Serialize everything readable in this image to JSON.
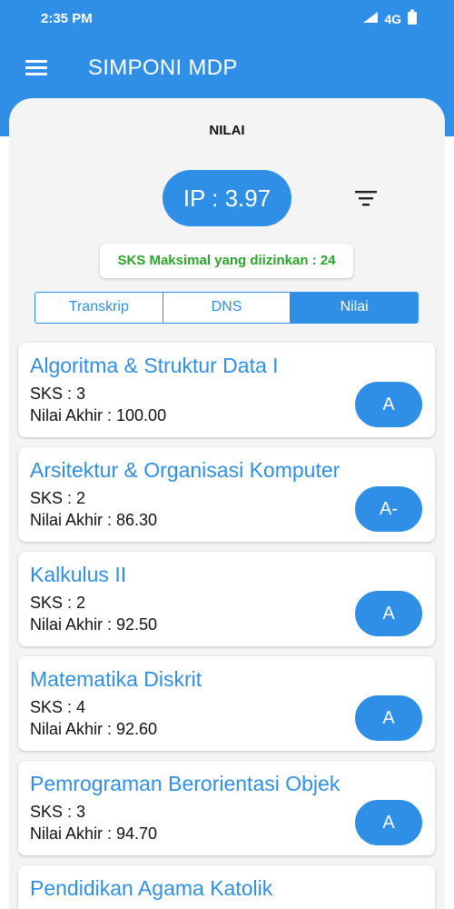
{
  "status_bar": {
    "time": "2:35 PM",
    "network": "4G",
    "icons": [
      "signal-icon",
      "network-4g-icon",
      "battery-icon"
    ]
  },
  "app_bar": {
    "title": "SIMPONI MDP",
    "menu_icon": "hamburger-menu-icon"
  },
  "page": {
    "title": "NILAI",
    "ip_text": "IP : 3.97",
    "filter_icon": "filter-icon",
    "sks_max_text": "SKS Maksimal yang diizinkan : 24"
  },
  "tabs": [
    {
      "label": "Transkrip",
      "active": false
    },
    {
      "label": "DNS",
      "active": false
    },
    {
      "label": "Nilai",
      "active": true
    }
  ],
  "courses": [
    {
      "name": "Algoritma & Struktur Data I",
      "sks": "SKS : 3",
      "nilai": "Nilai Akhir : 100.00",
      "grade": "A"
    },
    {
      "name": "Arsitektur & Organisasi Komputer",
      "sks": "SKS : 2",
      "nilai": "Nilai Akhir : 86.30",
      "grade": "A-"
    },
    {
      "name": "Kalkulus II",
      "sks": "SKS : 2",
      "nilai": "Nilai Akhir : 92.50",
      "grade": "A"
    },
    {
      "name": "Matematika Diskrit",
      "sks": "SKS : 4",
      "nilai": "Nilai Akhir : 92.60",
      "grade": "A"
    },
    {
      "name": "Pemrograman Berorientasi Objek",
      "sks": "SKS : 3",
      "nilai": "Nilai Akhir : 94.70",
      "grade": "A"
    },
    {
      "name": "Pendidikan Agama Katolik",
      "sks": "",
      "nilai": "",
      "grade": ""
    }
  ],
  "colors": {
    "primary": "#2f8fe6",
    "success_text": "#2aa52a",
    "background": "#f4f4f4"
  }
}
